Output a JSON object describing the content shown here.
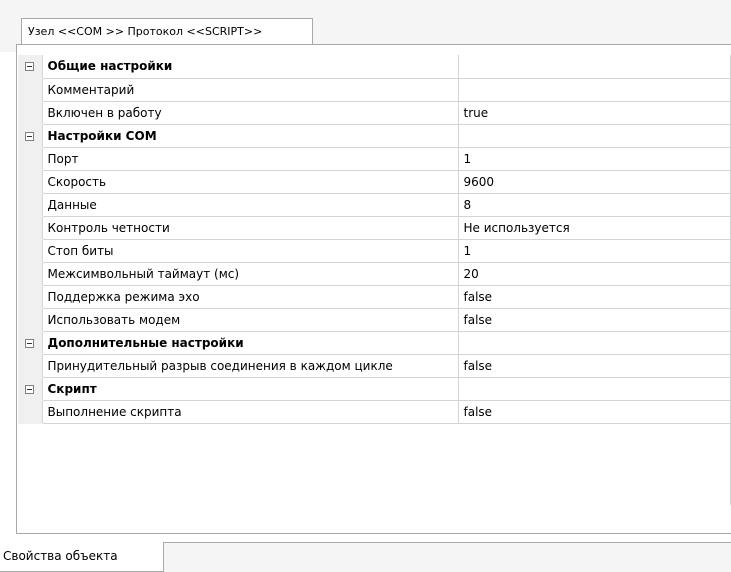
{
  "top_tab": {
    "label": "Узел <<COM  >> Протокол <<SCRIPT>>"
  },
  "properties": {
    "general": {
      "title": "Общие настройки",
      "rows": [
        {
          "name": "Комментарий",
          "value": ""
        },
        {
          "name": "Включен в работу",
          "value": "true"
        }
      ]
    },
    "com": {
      "title": "Настройки COM",
      "rows": [
        {
          "name": "Порт",
          "value": "1"
        },
        {
          "name": "Скорость",
          "value": "9600"
        },
        {
          "name": "Данные",
          "value": "8"
        },
        {
          "name": "Контроль четности",
          "value": "Не используется"
        },
        {
          "name": "Стоп биты",
          "value": "1"
        },
        {
          "name": "Межсимвольный таймаут (мс)",
          "value": "20"
        },
        {
          "name": "Поддержка режима эхо",
          "value": "false"
        },
        {
          "name": "Использовать модем",
          "value": "false"
        }
      ]
    },
    "extra": {
      "title": "Дополнительные настройки",
      "rows": [
        {
          "name": "Принудительный разрыв соединения в каждом цикле",
          "value": "false"
        }
      ]
    },
    "script": {
      "title": "Скрипт",
      "rows": [
        {
          "name": "Выполнение скрипта",
          "value": "false"
        }
      ]
    }
  },
  "bottom_tab": {
    "label": "Свойства объекта"
  }
}
